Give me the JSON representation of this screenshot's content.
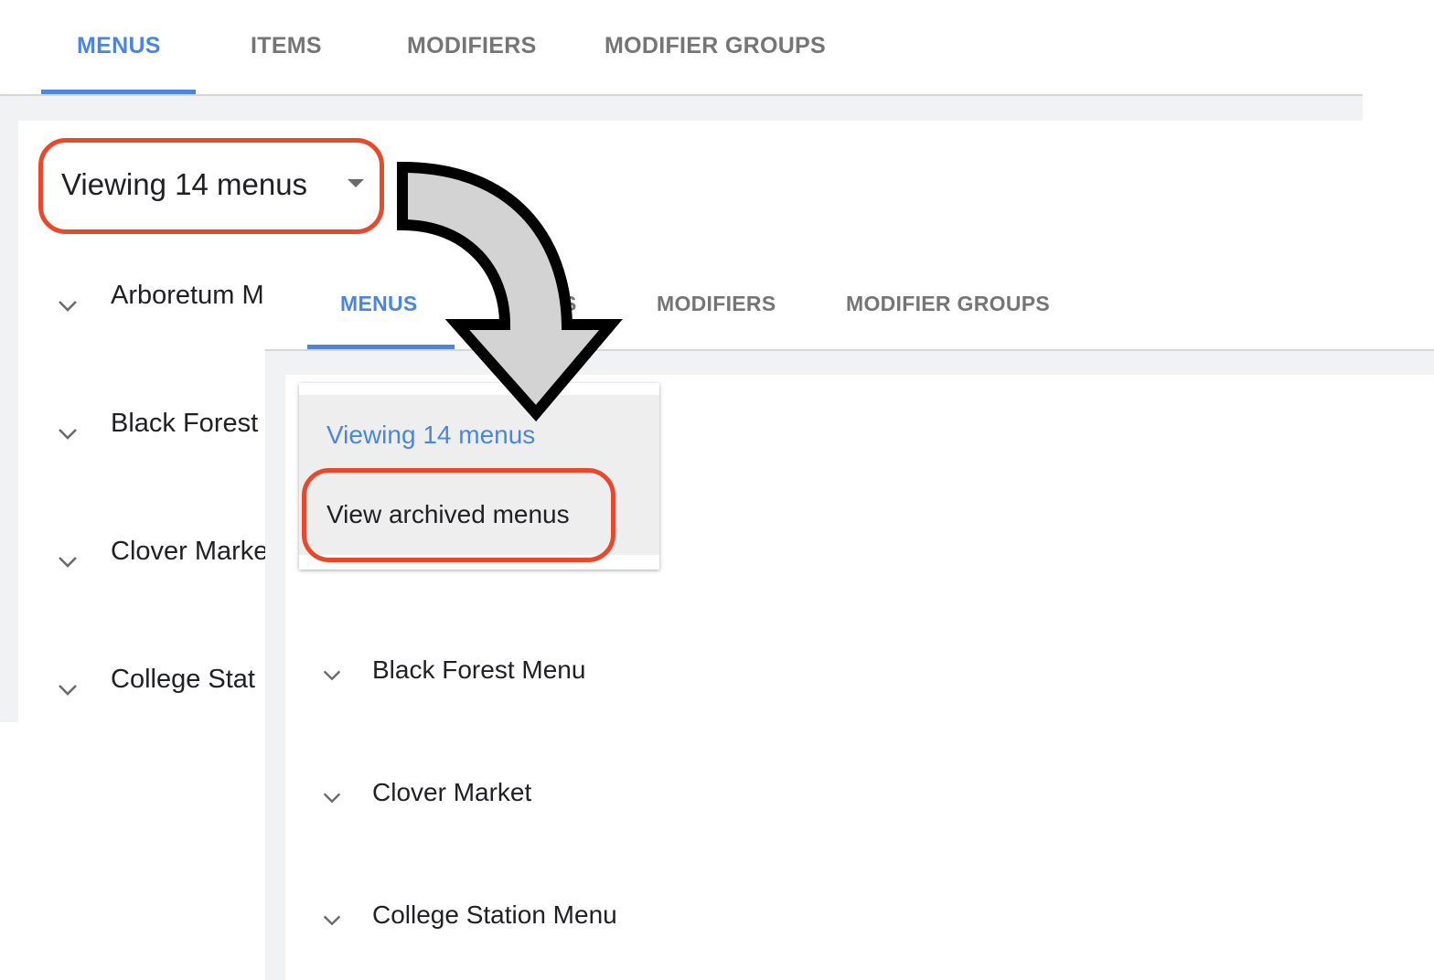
{
  "back_screen": {
    "tabs": [
      {
        "label": "MENUS",
        "active": true
      },
      {
        "label": "ITEMS",
        "active": false
      },
      {
        "label": "MODIFIERS",
        "active": false
      },
      {
        "label": "MODIFIER GROUPS",
        "active": false
      }
    ],
    "menu_select": {
      "value": "Viewing 14 menus",
      "icon": "caret-down-icon"
    },
    "menus": [
      {
        "label": "Arboretum M",
        "icon": "chevron-down-icon"
      },
      {
        "label": "Black Forest",
        "icon": "chevron-down-icon"
      },
      {
        "label": "Clover Marke",
        "icon": "chevron-down-icon"
      },
      {
        "label": "College Stat",
        "icon": "chevron-down-icon"
      }
    ]
  },
  "front_screen": {
    "tabs": [
      {
        "label": "MENUS",
        "active": true
      },
      {
        "label": "S",
        "active": false
      },
      {
        "label": "MODIFIERS",
        "active": false
      },
      {
        "label": "MODIFIER GROUPS",
        "active": false
      }
    ],
    "dropdown": {
      "options": [
        {
          "label": "Viewing 14 menus",
          "selected": true
        },
        {
          "label": "View archived menus",
          "selected": false
        }
      ]
    },
    "menus": [
      {
        "label": "Black Forest Menu",
        "icon": "chevron-down-icon"
      },
      {
        "label": "Clover Market",
        "icon": "chevron-down-icon"
      },
      {
        "label": "College Station Menu",
        "icon": "chevron-down-icon"
      }
    ]
  },
  "annotation": {
    "highlight_color": "#e8492b",
    "arrow_icon": "curved-arrow-icon",
    "arrow_fill": "#d3d3d3",
    "arrow_stroke": "#000000"
  },
  "colors": {
    "accent": "#4a86e0",
    "tab_inactive": "#757575",
    "text": "#202124",
    "background_gray": "#f1f2f4"
  }
}
